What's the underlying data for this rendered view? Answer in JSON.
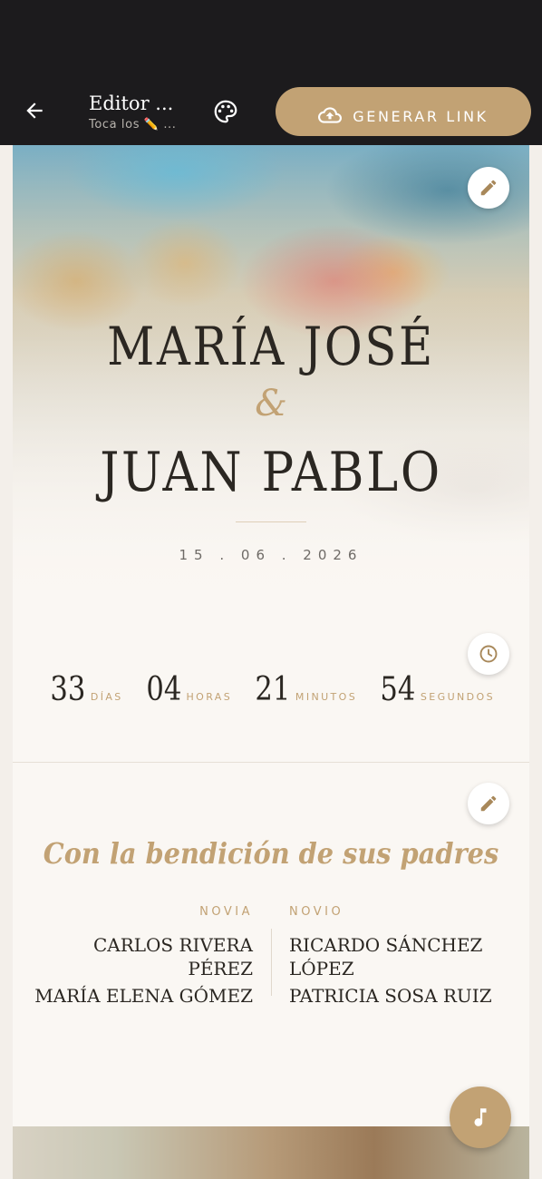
{
  "appbar": {
    "title": "Editor ...",
    "subtitle": "Toca los ✏️ ...",
    "generate_label": "GENERAR LINK"
  },
  "hero": {
    "name_1": "MARÍA JOSÉ",
    "ampersand": "&",
    "name_2": "JUAN PABLO",
    "date": "15 . 06 . 2026"
  },
  "countdown": [
    {
      "value": "33",
      "label": "DÍAS"
    },
    {
      "value": "04",
      "label": "HORAS"
    },
    {
      "value": "21",
      "label": "MINUTOS"
    },
    {
      "value": "54",
      "label": "SEGUNDOS"
    }
  ],
  "parents": {
    "heading": "Con la bendición de sus padres",
    "bride": {
      "label": "NOVIA",
      "names": [
        "CARLOS RIVERA PÉREZ",
        "MARÍA ELENA GÓMEZ"
      ]
    },
    "groom": {
      "label": "NOVIO",
      "names": [
        "RICARDO SÁNCHEZ LÓPEZ",
        "PATRICIA SOSA RUIZ"
      ]
    }
  },
  "icons": {
    "back": "arrow-left-icon",
    "palette": "palette-icon",
    "upload": "cloud-upload-icon",
    "edit": "pencil-icon",
    "clock": "clock-icon",
    "music": "music-note-icon"
  },
  "colors": {
    "accent": "#c2a274",
    "appbar": "#1c1b1d",
    "text_dark": "#2b2722",
    "background": "#faf7f3"
  }
}
